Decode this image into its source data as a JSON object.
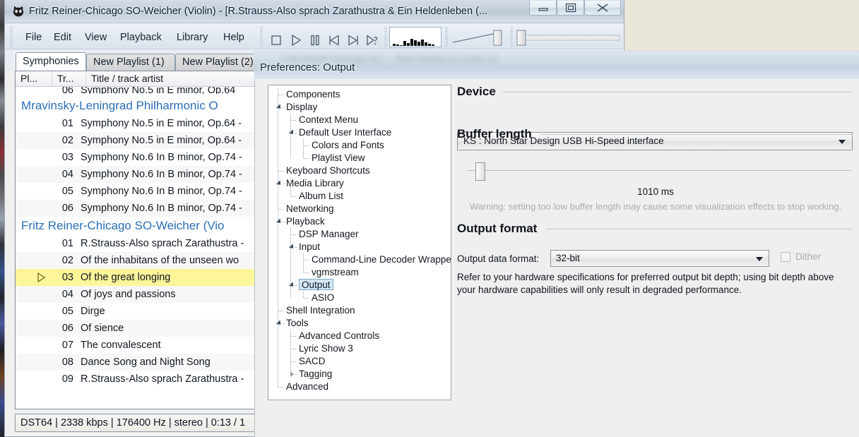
{
  "main_window": {
    "title": "Fritz Reiner-Chicago SO-Weicher (Violin) - [R.Strauss-Also sprach Zarathustra & Ein Heldenleben (...",
    "app_icon": "foobar2000-fox-icon",
    "window_controls": {
      "minimize": "minimize-icon",
      "maximize": "maximize-icon",
      "close": "close-icon"
    },
    "menu": [
      "File",
      "Edit",
      "View",
      "Playback",
      "Library",
      "Help"
    ],
    "toolbar_buttons": [
      "stop-icon",
      "play-icon",
      "pause-icon",
      "previous-icon",
      "next-icon",
      "random-icon"
    ],
    "visualizer": {
      "name": "spectrum-visualizer",
      "bars": [
        3,
        2,
        1,
        7,
        4,
        10,
        8,
        6,
        9,
        5,
        3,
        2
      ]
    },
    "volume_slider": {
      "name": "volume-slider",
      "position_pct": 88
    },
    "seek_slider": {
      "name": "seek-slider",
      "position_pct": 5
    }
  },
  "tabs": [
    {
      "label": "Symphonies",
      "active": true
    },
    {
      "label": "New Playlist (1)",
      "active": false
    },
    {
      "label": "New Playlist (2)",
      "active": false
    }
  ],
  "playlist": {
    "columns": [
      "Pl...",
      "Tr...",
      "Title / track artist"
    ],
    "clipped_top_row": "06  Symphony No.5 in E minor, Op.64",
    "rows": [
      {
        "type": "group",
        "title": "Mravinsky-Leningrad Philharmonic O"
      },
      {
        "type": "track",
        "num": "01",
        "title": "Symphony No.5 in E minor, Op.64 -"
      },
      {
        "type": "track",
        "num": "02",
        "title": "Symphony No.5 in E minor, Op.64 -"
      },
      {
        "type": "track",
        "num": "03",
        "title": "Symphony No.6 In B minor, Op.74 -"
      },
      {
        "type": "track",
        "num": "04",
        "title": "Symphony No.6 In B minor, Op.74 -"
      },
      {
        "type": "track",
        "num": "05",
        "title": "Symphony No.6 In B minor, Op.74 -"
      },
      {
        "type": "track",
        "num": "06",
        "title": "Symphony No.6 In B minor, Op.74 -"
      },
      {
        "type": "group",
        "title": "Fritz Reiner-Chicago SO-Weicher (Vio"
      },
      {
        "type": "track",
        "num": "01",
        "title": "R.Strauss-Also sprach Zarathustra -"
      },
      {
        "type": "track",
        "num": "02",
        "title": "Of the inhabitans of the unseen wo"
      },
      {
        "type": "track",
        "num": "03",
        "title": "Of the great longing",
        "playing": true
      },
      {
        "type": "track",
        "num": "04",
        "title": "Of joys and passions"
      },
      {
        "type": "track",
        "num": "05",
        "title": "Dirge"
      },
      {
        "type": "track",
        "num": "06",
        "title": "Of sience"
      },
      {
        "type": "track",
        "num": "07",
        "title": "The convalescent"
      },
      {
        "type": "track",
        "num": "08",
        "title": "Dance Song and Night Song"
      },
      {
        "type": "track",
        "num": "09",
        "title": "R.Strauss-Also sprach Zarathustra -"
      }
    ]
  },
  "status_bar": "DST64 | 2338 kbps | 176400 Hz | stereo | 0:13 / 1",
  "preferences": {
    "title": "Preferences: Output",
    "ghost_title": "Fritz Reiner-Chicago SO ... New Playlist (1)   Audio (2)",
    "help_button": "?",
    "close_button": "close-icon",
    "tree": [
      {
        "label": "Components",
        "depth": 0,
        "twisty": "none",
        "selected": false
      },
      {
        "label": "Display",
        "depth": 0,
        "twisty": "open",
        "selected": false
      },
      {
        "label": "Context Menu",
        "depth": 1,
        "twisty": "none",
        "selected": false
      },
      {
        "label": "Default User Interface",
        "depth": 1,
        "twisty": "open",
        "selected": false
      },
      {
        "label": "Colors and Fonts",
        "depth": 2,
        "twisty": "none",
        "selected": false
      },
      {
        "label": "Playlist View",
        "depth": 2,
        "twisty": "none",
        "selected": false
      },
      {
        "label": "Keyboard Shortcuts",
        "depth": 0,
        "twisty": "none",
        "selected": false
      },
      {
        "label": "Media Library",
        "depth": 0,
        "twisty": "open",
        "selected": false
      },
      {
        "label": "Album List",
        "depth": 1,
        "twisty": "none",
        "selected": false
      },
      {
        "label": "Networking",
        "depth": 0,
        "twisty": "none",
        "selected": false
      },
      {
        "label": "Playback",
        "depth": 0,
        "twisty": "open",
        "selected": false
      },
      {
        "label": "DSP Manager",
        "depth": 1,
        "twisty": "none",
        "selected": false
      },
      {
        "label": "Input",
        "depth": 1,
        "twisty": "open",
        "selected": false
      },
      {
        "label": "Command-Line Decoder Wrapper",
        "depth": 2,
        "twisty": "none",
        "selected": false
      },
      {
        "label": "vgmstream",
        "depth": 2,
        "twisty": "none",
        "selected": false
      },
      {
        "label": "Output",
        "depth": 1,
        "twisty": "open",
        "selected": true
      },
      {
        "label": "ASIO",
        "depth": 2,
        "twisty": "none",
        "selected": false
      },
      {
        "label": "Shell Integration",
        "depth": 0,
        "twisty": "none",
        "selected": false
      },
      {
        "label": "Tools",
        "depth": 0,
        "twisty": "open",
        "selected": false
      },
      {
        "label": "Advanced Controls",
        "depth": 1,
        "twisty": "none",
        "selected": false
      },
      {
        "label": "Lyric Show 3",
        "depth": 1,
        "twisty": "none",
        "selected": false
      },
      {
        "label": "SACD",
        "depth": 1,
        "twisty": "none",
        "selected": false
      },
      {
        "label": "Tagging",
        "depth": 1,
        "twisty": "closed",
        "selected": false
      },
      {
        "label": "Advanced",
        "depth": 0,
        "twisty": "none",
        "selected": false
      }
    ],
    "device": {
      "group_title": "Device",
      "selected": "KS : North Star Design USB Hi-Speed interface"
    },
    "buffer": {
      "group_title": "Buffer length",
      "value": "1010 ms",
      "slider_pct": 3,
      "warning": "Warning: setting too low buffer length may cause some visualization effects to stop working."
    },
    "output_format": {
      "group_title": "Output format",
      "label": "Output data format:",
      "selected": "32-bit",
      "dither_label": "Dither",
      "dither_checked": false,
      "note": "Refer to your hardware specifications for preferred output bit depth; using bit depth above your hardware capabilities will only result in degraded performance."
    }
  },
  "colors": {
    "selection_yellow": "#fcf59a",
    "group_blue": "#2a6fb5",
    "close_red": "#cf3a27",
    "tree_select": "#d4e7f7"
  }
}
